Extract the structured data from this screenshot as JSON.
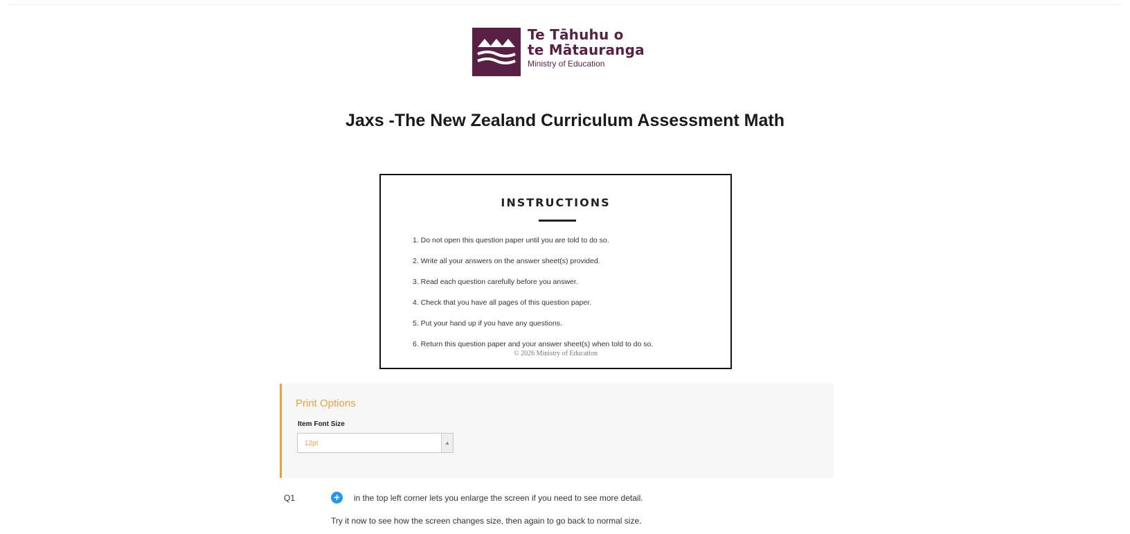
{
  "branding": {
    "logo_icon": "ministry-waves-icon",
    "logo_line1": "Te Tāhuhu o",
    "logo_line2": "te Mātauranga",
    "logo_subtitle": "Ministry of Education",
    "brand_color": "#5a1f44"
  },
  "page": {
    "title": "Jaxs -The New Zealand Curriculum Assessment Math"
  },
  "instructions": {
    "heading": "INSTRUCTIONS",
    "items": [
      "1. Do not open this question paper until you are told to do so.",
      "2. Write all your answers on the answer sheet(s) provided.",
      "3. Read each question carefully before you answer.",
      "4. Check that you have all pages of this question paper.",
      "5. Put your hand up if you have any questions.",
      "6. Return this question paper and your answer sheet(s) when told to do so."
    ],
    "copyright": "© 2026 Ministry of Education"
  },
  "print_options": {
    "title": "Print Options",
    "font_size_label": "Item Font Size",
    "font_size_value": "12pt",
    "accent_color": "#e8a33a"
  },
  "question": {
    "number": "Q1",
    "icon": "zoom-plus-icon",
    "line1": "in the top left corner lets you enlarge the screen if you need to see more detail.",
    "line2": "Try it now to see how the screen changes size, then again to go back to normal size."
  }
}
